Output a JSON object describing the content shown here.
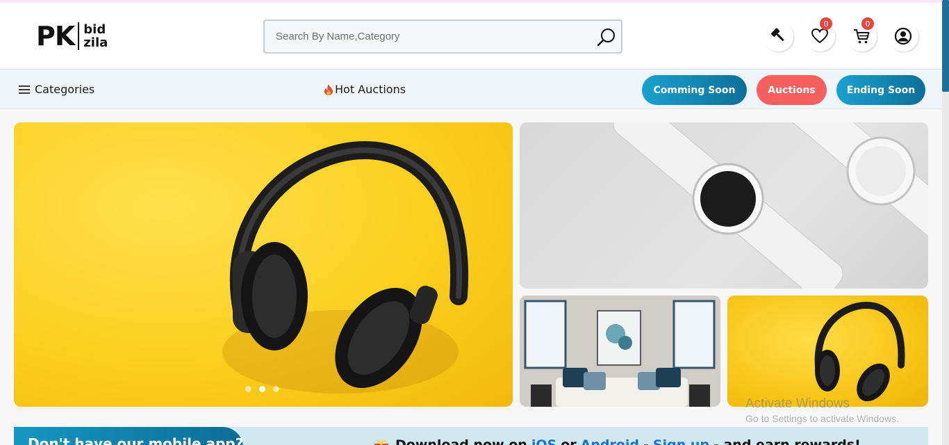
{
  "header": {
    "logo": {
      "mark": "PK",
      "line1": "bid",
      "line2": "zila"
    },
    "search": {
      "placeholder": "Search By Name,Category",
      "value": ""
    },
    "wishlist_count": "0",
    "cart_count": "0"
  },
  "nav": {
    "categories_label": "Categories",
    "hot_label": "Hot Auctions",
    "buttons": [
      {
        "label": "Comming Soon",
        "color": "#1497c4"
      },
      {
        "label": "Auctions",
        "color": "#f7605d"
      },
      {
        "label": "Ending Soon",
        "color": "#1497c4"
      }
    ]
  },
  "hero": {
    "slide_count": 3,
    "active_slide": 2,
    "tiles": [
      "headphones",
      "smartwatches",
      "living-room",
      "headphones"
    ]
  },
  "banner": {
    "left_text": "Don't have our mobile app?",
    "prefix": "Download now on",
    "ios": "iOS",
    "or": "or",
    "android": "Android",
    "dash": "-",
    "signup": "Sign up",
    "suffix": "- and earn rewards!"
  },
  "watermark": {
    "line1": "Activate Windows",
    "line2": "Go to Settings to activate Windows."
  },
  "icons": [
    "search-icon",
    "gavel-icon",
    "heart-icon",
    "cart-icon",
    "user-icon",
    "menu-icon",
    "fire-icon"
  ],
  "colors": {
    "accent_blue": "#1497c4",
    "accent_red": "#f7605d",
    "badge_red": "#e8463d"
  }
}
